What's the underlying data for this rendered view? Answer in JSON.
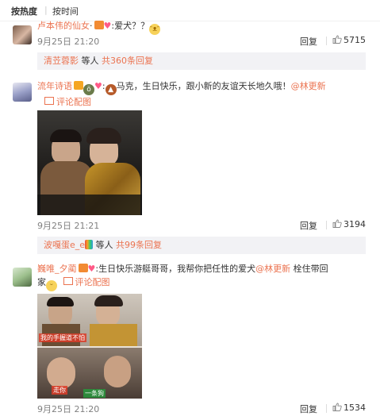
{
  "sort": {
    "hot": "按热度",
    "time": "按时间"
  },
  "comments": [
    {
      "username": "卢本伟的仙女",
      "punct": ":",
      "text": "爱犬？？",
      "time": "9月25日 21:20",
      "reply": "回复",
      "likes": "5715",
      "sub": {
        "user": "清苙蓉影",
        "mid": " 等人 ",
        "more": "共360条回复"
      }
    },
    {
      "username": "流年诗语",
      "punct": ":",
      "text_before": "马克，生日快乐，跟小新的友谊天长地久哦！",
      "mention": "@林更新",
      "picnote": "评论配图",
      "time": "9月25日 21:21",
      "reply": "回复",
      "likes": "3194",
      "sub": {
        "user": "波嘎蛋e_e",
        "mid": " 等人 ",
        "more": "共99条回复"
      }
    },
    {
      "username": "巍唯_夕蔺",
      "punct": ":",
      "text_before": "生日快乐游艇哥哥，我帮你把任性的爱犬",
      "mention": "@林更新",
      "text_after_line1": " 栓住带回",
      "text_after_line2": "家",
      "picnote": "评论配图",
      "meme_cap1": "我的手握道不怕",
      "meme_cap2": "走你",
      "meme_cap3": "一条狗",
      "time": "9月25日 21:20",
      "reply": "回复",
      "likes": "1534"
    }
  ],
  "colors": {
    "link": "#eb7350",
    "muted": "#808080",
    "subbox": "#f2f2f5",
    "heart": "#ff5a87"
  }
}
